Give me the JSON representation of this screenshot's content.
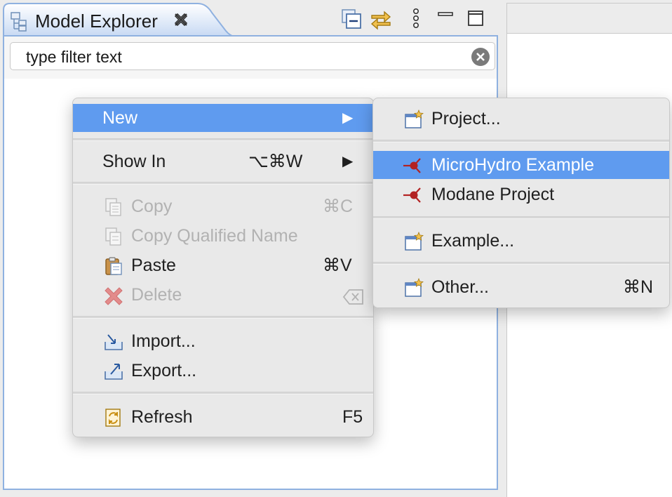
{
  "view": {
    "title": "Model Explorer",
    "filter_placeholder": "type filter text"
  },
  "context_menu": {
    "new": {
      "label": "New",
      "arrow": "▶"
    },
    "show_in": {
      "label": "Show In",
      "shortcut": "⌥⌘W",
      "arrow": "▶"
    },
    "copy": {
      "label": "Copy",
      "shortcut": "⌘C"
    },
    "copy_qualified_name": {
      "label": "Copy Qualified Name"
    },
    "paste": {
      "label": "Paste",
      "shortcut": "⌘V"
    },
    "delete": {
      "label": "Delete"
    },
    "import": {
      "label": "Import..."
    },
    "export": {
      "label": "Export..."
    },
    "refresh": {
      "label": "Refresh",
      "shortcut": "F5"
    }
  },
  "submenu": {
    "project": {
      "label": "Project..."
    },
    "microhydro": {
      "label": "MicroHydro Example"
    },
    "modane": {
      "label": "Modane Project"
    },
    "example": {
      "label": "Example..."
    },
    "other": {
      "label": "Other...",
      "shortcut": "⌘N"
    }
  },
  "colors": {
    "highlight": "#5f9bef",
    "frame_border": "#8fb1e0",
    "disabled_text": "#b2b2b2",
    "delete_icon": "#e38b8b",
    "modane_icon": "#b32222"
  }
}
